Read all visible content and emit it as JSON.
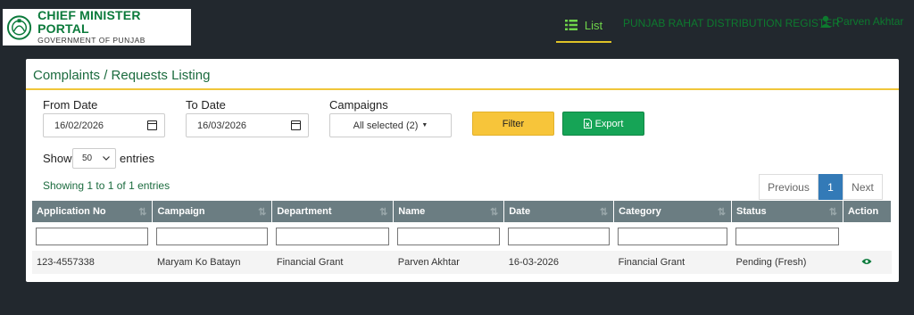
{
  "header": {
    "logo_title": "CHIEF MINISTER PORTAL",
    "logo_subtitle": "GOVERNMENT OF PUNJAB",
    "nav_list": "List",
    "nav_second": "PUNJAB RAHAT DISTRIBUTION REGISTER",
    "nav_user": "Parven Akhtar"
  },
  "panel": {
    "title": "Complaints / Requests Listing"
  },
  "filters": {
    "from_label": "From Date",
    "from_value": "16/02/2026",
    "to_label": "To Date",
    "to_value": "16/03/2026",
    "campaigns_label": "Campaigns",
    "campaigns_value": "All selected (2)",
    "filter_button": "Filter",
    "export_button": "Export"
  },
  "entries": {
    "show_label": "Show",
    "page_size": "50",
    "entries_label": "entries",
    "info": "Showing 1 to 1 of 1 entries"
  },
  "pagination": {
    "previous": "Previous",
    "current": "1",
    "next": "Next"
  },
  "table": {
    "columns": [
      "Application No",
      "Campaign",
      "Department",
      "Name",
      "Date",
      "Category",
      "Status",
      "Action"
    ],
    "rows": [
      {
        "application_no": "123-4557338",
        "campaign": "Maryam Ko Batayn",
        "department": "Financial Grant",
        "name": "Parven Akhtar",
        "date": "16-03-2026",
        "category": "Financial Grant",
        "status": "Pending (Fresh)",
        "action_icon": "eye-icon"
      }
    ]
  },
  "colors": {
    "accent_green": "#0b7a3b",
    "header_yellow": "#f0c63a",
    "table_header": "#6b7d82",
    "page_bg": "#22282e"
  }
}
